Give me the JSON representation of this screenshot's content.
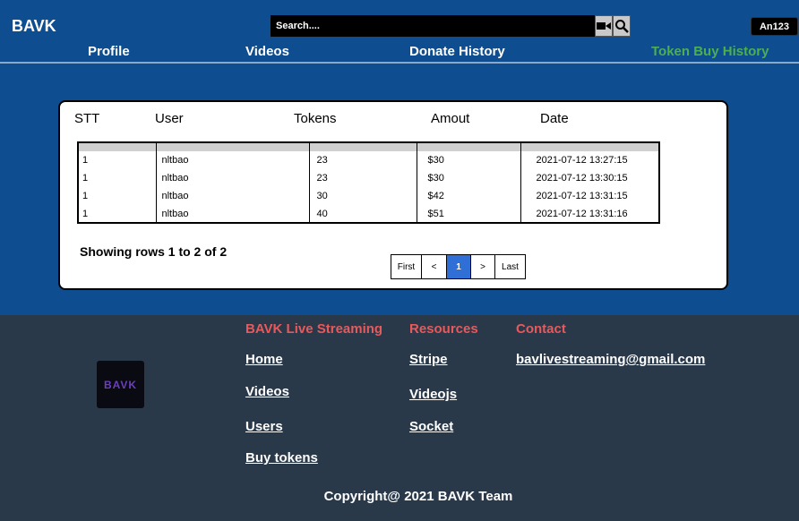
{
  "brand": "BAVK",
  "search": {
    "placeholder": "Search...."
  },
  "user": {
    "name": "An123"
  },
  "nav": {
    "profile": "Profile",
    "videos": "Videos",
    "donate": "Donate History",
    "token": "Token Buy History"
  },
  "table": {
    "columns": [
      "STT",
      "User",
      "Tokens",
      "Amout",
      "Date"
    ],
    "rows": [
      [
        "1",
        "nltbao",
        "23",
        "$30",
        "2021-07-12 13:27:15"
      ],
      [
        "1",
        "nltbao",
        "23",
        "$30",
        "2021-07-12 13:30:15"
      ],
      [
        "1",
        "nltbao",
        "30",
        "$42",
        "2021-07-12 13:31:15"
      ],
      [
        "1",
        "nltbao",
        "40",
        "$51",
        "2021-07-12 13:31:16"
      ]
    ]
  },
  "showing": "Showing rows 1 to 2 of 2",
  "pager": {
    "first": "First",
    "prev": "<",
    "page": "1",
    "next": ">",
    "last": "Last"
  },
  "footer": {
    "logo": "BAVK",
    "col1": {
      "title": "BAVK Live Streaming",
      "links": [
        "Home",
        "Videos",
        "Users",
        "Buy tokens"
      ]
    },
    "col2": {
      "title": "Resources",
      "links": [
        "Stripe",
        "Videojs",
        "Socket"
      ]
    },
    "col3": {
      "title": "Contact",
      "email": "bavlivestreaming@gmail.com"
    },
    "copyright": "Copyright@ 2021 BAVK Team"
  },
  "colors": {
    "header_bg": "#0e4d8f",
    "footer_bg": "#29394a",
    "active_nav": "#4caf50",
    "footer_heading": "#e8595c",
    "pager_active": "#2f6fd6"
  },
  "icons": [
    "video-camera-icon",
    "search-icon"
  ]
}
